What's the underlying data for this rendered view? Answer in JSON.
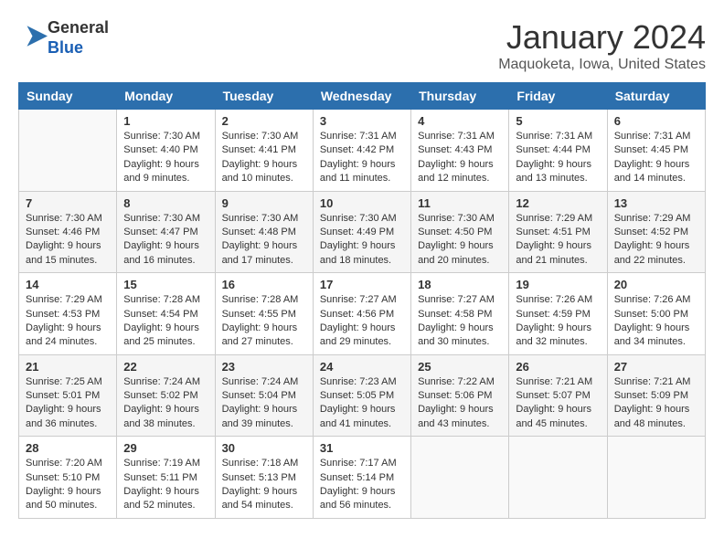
{
  "header": {
    "logo_line1": "General",
    "logo_line2": "Blue",
    "title": "January 2024",
    "subtitle": "Maquoketa, Iowa, United States"
  },
  "calendar": {
    "headers": [
      "Sunday",
      "Monday",
      "Tuesday",
      "Wednesday",
      "Thursday",
      "Friday",
      "Saturday"
    ],
    "weeks": [
      [
        {
          "day": "",
          "sunrise": "",
          "sunset": "",
          "daylight": ""
        },
        {
          "day": "1",
          "sunrise": "Sunrise: 7:30 AM",
          "sunset": "Sunset: 4:40 PM",
          "daylight": "Daylight: 9 hours and 9 minutes."
        },
        {
          "day": "2",
          "sunrise": "Sunrise: 7:30 AM",
          "sunset": "Sunset: 4:41 PM",
          "daylight": "Daylight: 9 hours and 10 minutes."
        },
        {
          "day": "3",
          "sunrise": "Sunrise: 7:31 AM",
          "sunset": "Sunset: 4:42 PM",
          "daylight": "Daylight: 9 hours and 11 minutes."
        },
        {
          "day": "4",
          "sunrise": "Sunrise: 7:31 AM",
          "sunset": "Sunset: 4:43 PM",
          "daylight": "Daylight: 9 hours and 12 minutes."
        },
        {
          "day": "5",
          "sunrise": "Sunrise: 7:31 AM",
          "sunset": "Sunset: 4:44 PM",
          "daylight": "Daylight: 9 hours and 13 minutes."
        },
        {
          "day": "6",
          "sunrise": "Sunrise: 7:31 AM",
          "sunset": "Sunset: 4:45 PM",
          "daylight": "Daylight: 9 hours and 14 minutes."
        }
      ],
      [
        {
          "day": "7",
          "sunrise": "Sunrise: 7:30 AM",
          "sunset": "Sunset: 4:46 PM",
          "daylight": "Daylight: 9 hours and 15 minutes."
        },
        {
          "day": "8",
          "sunrise": "Sunrise: 7:30 AM",
          "sunset": "Sunset: 4:47 PM",
          "daylight": "Daylight: 9 hours and 16 minutes."
        },
        {
          "day": "9",
          "sunrise": "Sunrise: 7:30 AM",
          "sunset": "Sunset: 4:48 PM",
          "daylight": "Daylight: 9 hours and 17 minutes."
        },
        {
          "day": "10",
          "sunrise": "Sunrise: 7:30 AM",
          "sunset": "Sunset: 4:49 PM",
          "daylight": "Daylight: 9 hours and 18 minutes."
        },
        {
          "day": "11",
          "sunrise": "Sunrise: 7:30 AM",
          "sunset": "Sunset: 4:50 PM",
          "daylight": "Daylight: 9 hours and 20 minutes."
        },
        {
          "day": "12",
          "sunrise": "Sunrise: 7:29 AM",
          "sunset": "Sunset: 4:51 PM",
          "daylight": "Daylight: 9 hours and 21 minutes."
        },
        {
          "day": "13",
          "sunrise": "Sunrise: 7:29 AM",
          "sunset": "Sunset: 4:52 PM",
          "daylight": "Daylight: 9 hours and 22 minutes."
        }
      ],
      [
        {
          "day": "14",
          "sunrise": "Sunrise: 7:29 AM",
          "sunset": "Sunset: 4:53 PM",
          "daylight": "Daylight: 9 hours and 24 minutes."
        },
        {
          "day": "15",
          "sunrise": "Sunrise: 7:28 AM",
          "sunset": "Sunset: 4:54 PM",
          "daylight": "Daylight: 9 hours and 25 minutes."
        },
        {
          "day": "16",
          "sunrise": "Sunrise: 7:28 AM",
          "sunset": "Sunset: 4:55 PM",
          "daylight": "Daylight: 9 hours and 27 minutes."
        },
        {
          "day": "17",
          "sunrise": "Sunrise: 7:27 AM",
          "sunset": "Sunset: 4:56 PM",
          "daylight": "Daylight: 9 hours and 29 minutes."
        },
        {
          "day": "18",
          "sunrise": "Sunrise: 7:27 AM",
          "sunset": "Sunset: 4:58 PM",
          "daylight": "Daylight: 9 hours and 30 minutes."
        },
        {
          "day": "19",
          "sunrise": "Sunrise: 7:26 AM",
          "sunset": "Sunset: 4:59 PM",
          "daylight": "Daylight: 9 hours and 32 minutes."
        },
        {
          "day": "20",
          "sunrise": "Sunrise: 7:26 AM",
          "sunset": "Sunset: 5:00 PM",
          "daylight": "Daylight: 9 hours and 34 minutes."
        }
      ],
      [
        {
          "day": "21",
          "sunrise": "Sunrise: 7:25 AM",
          "sunset": "Sunset: 5:01 PM",
          "daylight": "Daylight: 9 hours and 36 minutes."
        },
        {
          "day": "22",
          "sunrise": "Sunrise: 7:24 AM",
          "sunset": "Sunset: 5:02 PM",
          "daylight": "Daylight: 9 hours and 38 minutes."
        },
        {
          "day": "23",
          "sunrise": "Sunrise: 7:24 AM",
          "sunset": "Sunset: 5:04 PM",
          "daylight": "Daylight: 9 hours and 39 minutes."
        },
        {
          "day": "24",
          "sunrise": "Sunrise: 7:23 AM",
          "sunset": "Sunset: 5:05 PM",
          "daylight": "Daylight: 9 hours and 41 minutes."
        },
        {
          "day": "25",
          "sunrise": "Sunrise: 7:22 AM",
          "sunset": "Sunset: 5:06 PM",
          "daylight": "Daylight: 9 hours and 43 minutes."
        },
        {
          "day": "26",
          "sunrise": "Sunrise: 7:21 AM",
          "sunset": "Sunset: 5:07 PM",
          "daylight": "Daylight: 9 hours and 45 minutes."
        },
        {
          "day": "27",
          "sunrise": "Sunrise: 7:21 AM",
          "sunset": "Sunset: 5:09 PM",
          "daylight": "Daylight: 9 hours and 48 minutes."
        }
      ],
      [
        {
          "day": "28",
          "sunrise": "Sunrise: 7:20 AM",
          "sunset": "Sunset: 5:10 PM",
          "daylight": "Daylight: 9 hours and 50 minutes."
        },
        {
          "day": "29",
          "sunrise": "Sunrise: 7:19 AM",
          "sunset": "Sunset: 5:11 PM",
          "daylight": "Daylight: 9 hours and 52 minutes."
        },
        {
          "day": "30",
          "sunrise": "Sunrise: 7:18 AM",
          "sunset": "Sunset: 5:13 PM",
          "daylight": "Daylight: 9 hours and 54 minutes."
        },
        {
          "day": "31",
          "sunrise": "Sunrise: 7:17 AM",
          "sunset": "Sunset: 5:14 PM",
          "daylight": "Daylight: 9 hours and 56 minutes."
        },
        {
          "day": "",
          "sunrise": "",
          "sunset": "",
          "daylight": ""
        },
        {
          "day": "",
          "sunrise": "",
          "sunset": "",
          "daylight": ""
        },
        {
          "day": "",
          "sunrise": "",
          "sunset": "",
          "daylight": ""
        }
      ]
    ]
  }
}
